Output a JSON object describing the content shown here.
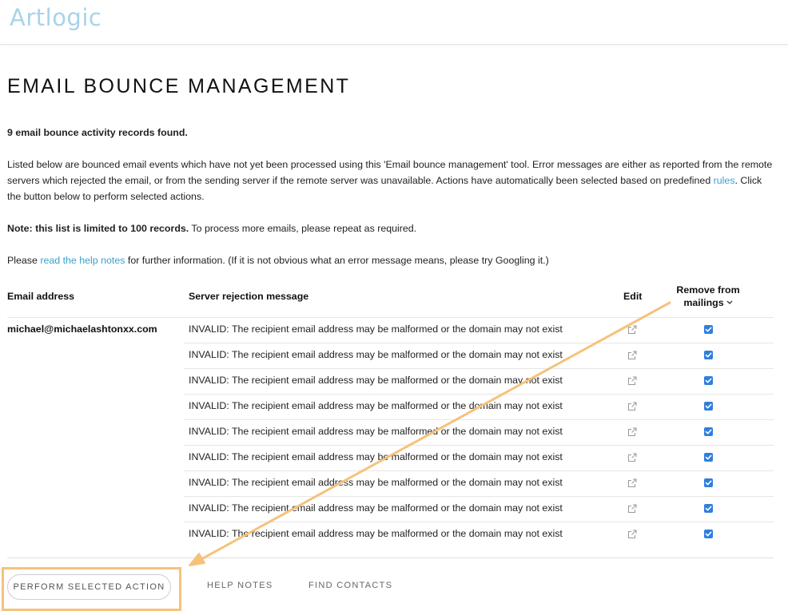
{
  "header": {
    "logo": "Artlogic"
  },
  "page": {
    "title": "EMAIL BOUNCE MANAGEMENT",
    "records_found": "9 email bounce activity records found.",
    "intro_text": "Listed below are bounced email events which have not yet been processed using this 'Email bounce management' tool. Error messages are either as reported from the remote servers which rejected the email, or from the sending server if the remote server was unavailable. Actions have automatically been selected based on predefined ",
    "intro_link": "rules",
    "intro_end": ". Click the button below to perform selected actions.",
    "note_bold": "Note: this list is limited to 100 records.",
    "note_rest": " To process more emails, please repeat as required.",
    "help_prefix": "Please ",
    "help_link": "read the help notes",
    "help_suffix": " for further information. (If it is not obvious what an error message means, please try Googling it.)"
  },
  "table": {
    "headers": {
      "email": "Email address",
      "message": "Server rejection message",
      "edit": "Edit",
      "remove_line1": "Remove from",
      "remove_line2": "mailings"
    },
    "rows": [
      {
        "email": "michael@michaelashtonxx.com",
        "message": "INVALID: The recipient email address may be malformed or the domain may not exist",
        "checked": true
      },
      {
        "email": "",
        "message": "INVALID: The recipient email address may be malformed or the domain may not exist",
        "checked": true
      },
      {
        "email": "",
        "message": "INVALID: The recipient email address may be malformed or the domain may not exist",
        "checked": true
      },
      {
        "email": "",
        "message": "INVALID: The recipient email address may be malformed or the domain may not exist",
        "checked": true
      },
      {
        "email": "",
        "message": "INVALID: The recipient email address may be malformed or the domain may not exist",
        "checked": true
      },
      {
        "email": "",
        "message": "INVALID: The recipient email address may be malformed or the domain may not exist",
        "checked": true
      },
      {
        "email": "",
        "message": "INVALID: The recipient email address may be malformed or the domain may not exist",
        "checked": true
      },
      {
        "email": "",
        "message": "INVALID: The recipient email address may be malformed or the domain may not exist",
        "checked": true
      },
      {
        "email": "",
        "message": "INVALID: The recipient email address may be malformed or the domain may not exist",
        "checked": true
      }
    ]
  },
  "actions": {
    "perform": "PERFORM SELECTED ACTION",
    "help_notes": "HELP NOTES",
    "find_contacts": "FIND CONTACTS"
  },
  "colors": {
    "accent": "#3aa0cf",
    "logo": "#a9d3ea",
    "checkbox": "#2f7fde",
    "highlight": "#f5c27b"
  },
  "icons": {
    "edit": "external-link-icon",
    "sort": "chevron-down-icon"
  }
}
